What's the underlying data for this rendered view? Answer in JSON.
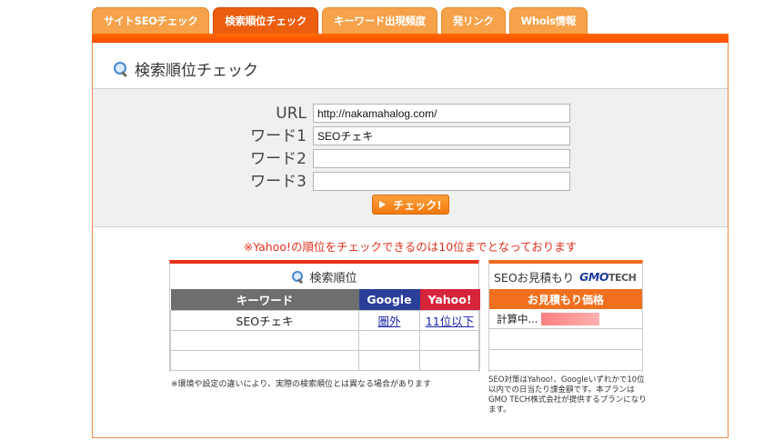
{
  "tabs": [
    {
      "label": "サイトSEOチェック",
      "active": false
    },
    {
      "label": "検索順位チェック",
      "active": true
    },
    {
      "label": "キーワード出現頻度",
      "active": false
    },
    {
      "label": "発リンク",
      "active": false
    },
    {
      "label": "Whois情報",
      "active": false
    }
  ],
  "panel": {
    "title": "検索順位チェック",
    "form": {
      "url_label": "URL",
      "url_value": "http://nakamahalog.com/",
      "word1_label": "ワード1",
      "word1_value": "SEOチェキ",
      "word2_label": "ワード2",
      "word2_value": "",
      "word3_label": "ワード3",
      "word3_value": "",
      "check_button": "チェック!"
    },
    "notice": "※Yahoo!の順位をチェックできるのは10位までとなっております"
  },
  "results": {
    "title": "検索順位",
    "headers": {
      "keyword": "キーワード",
      "google": "Google",
      "yahoo": "Yahoo!"
    },
    "rows": [
      {
        "keyword": "SEOチェキ",
        "google": "圏外",
        "yahoo": "11位以下"
      },
      {
        "keyword": "",
        "google": "",
        "yahoo": ""
      },
      {
        "keyword": "",
        "google": "",
        "yahoo": ""
      }
    ],
    "note": "※環境や設定の違いにより、実際の検索順位とは異なる場合があります"
  },
  "estimate": {
    "title": "SEOお見積もり",
    "brand_main": "GMO",
    "brand_sub": "TECH",
    "header": "お見積もり価格",
    "status": "計算中...",
    "note": "SEO対策はYahoo!、Googleいずれかで10位以内での日当たり課金額です。本プランはGMO TECH株式会社が提供するプランになります。"
  },
  "colors": {
    "tab": "#f6a24a",
    "tab_active": "#ec5e0f",
    "accent": "#ff5a00",
    "google": "#2b3f99",
    "yahoo": "#d6243a"
  }
}
